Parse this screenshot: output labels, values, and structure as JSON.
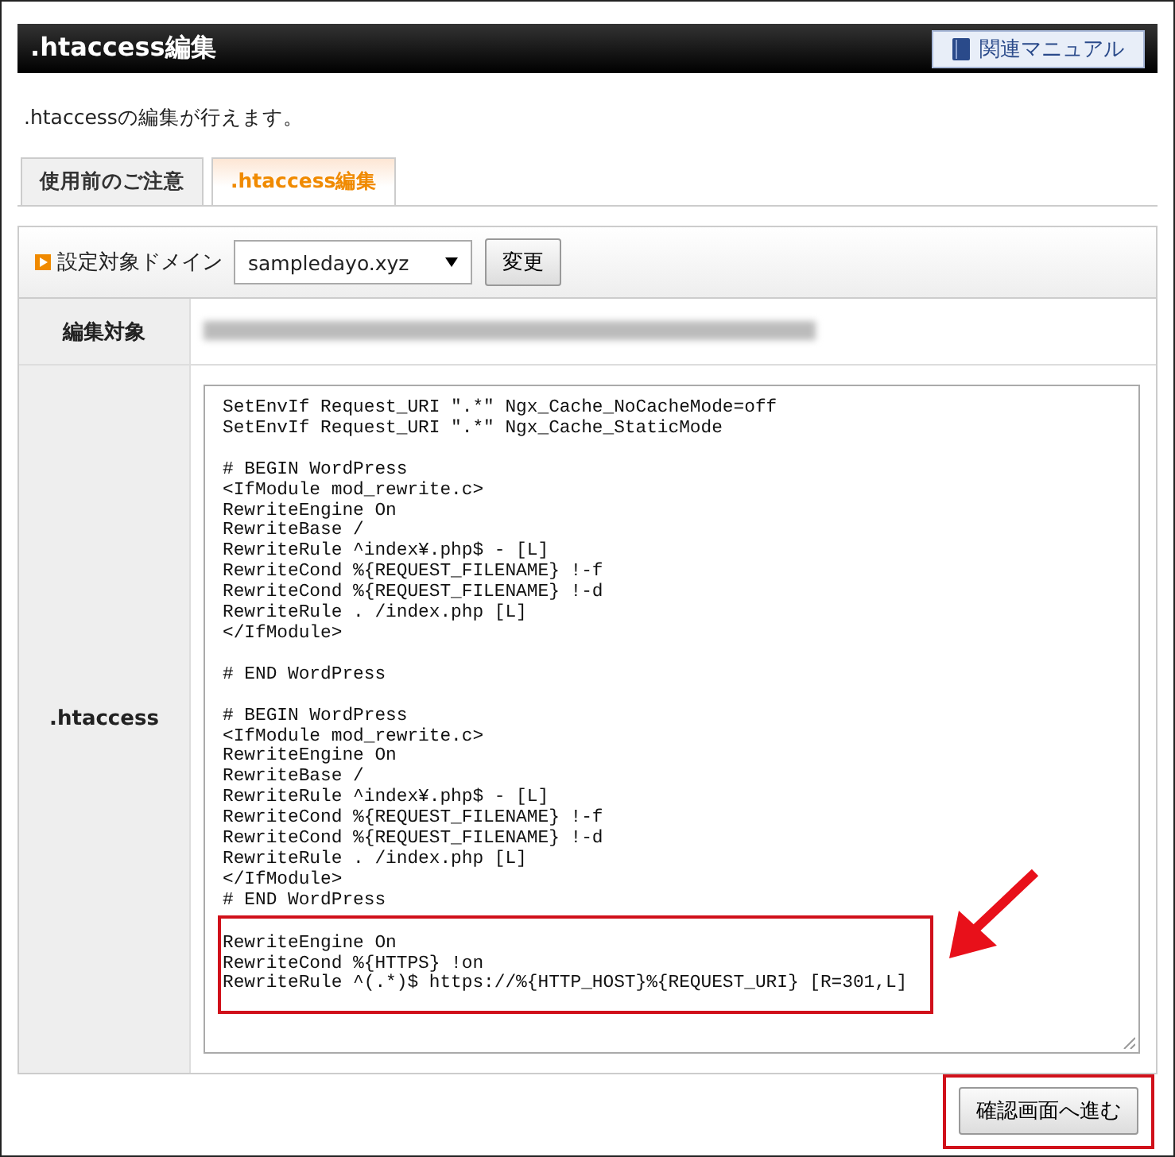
{
  "header": {
    "title": ".htaccess編集",
    "manual_button": "関連マニュアル"
  },
  "description": ".htaccessの編集が行えます。",
  "tabs": [
    {
      "label": "使用前のご注意",
      "selected": false
    },
    {
      "label": ".htaccess編集",
      "selected": true
    }
  ],
  "domain_row": {
    "label": "設定対象ドメイン",
    "select_value": "sampledayo.xyz",
    "change_button": "変更"
  },
  "target_row": {
    "label": "編集対象"
  },
  "htaccess_row": {
    "label": ".htaccess",
    "code": "SetEnvIf Request_URI \".*\" Ngx_Cache_NoCacheMode=off\nSetEnvIf Request_URI \".*\" Ngx_Cache_StaticMode\n\n# BEGIN WordPress\n<IfModule mod_rewrite.c>\nRewriteEngine On\nRewriteBase /\nRewriteRule ^index¥.php$ - [L]\nRewriteCond %{REQUEST_FILENAME} !-f\nRewriteCond %{REQUEST_FILENAME} !-d\nRewriteRule . /index.php [L]\n</IfModule>\n\n# END WordPress\n\n# BEGIN WordPress\n<IfModule mod_rewrite.c>\nRewriteEngine On\nRewriteBase /\nRewriteRule ^index¥.php$ - [L]\nRewriteCond %{REQUEST_FILENAME} !-f\nRewriteCond %{REQUEST_FILENAME} !-d\nRewriteRule . /index.php [L]\n</IfModule>\n# END WordPress",
    "highlighted_code": "RewriteEngine On\nRewriteCond %{HTTPS} !on\nRewriteRule ^(.*)$ https://%{HTTP_HOST}%{REQUEST_URI} [R=301,L]"
  },
  "confirm_button": "確認画面へ進む"
}
